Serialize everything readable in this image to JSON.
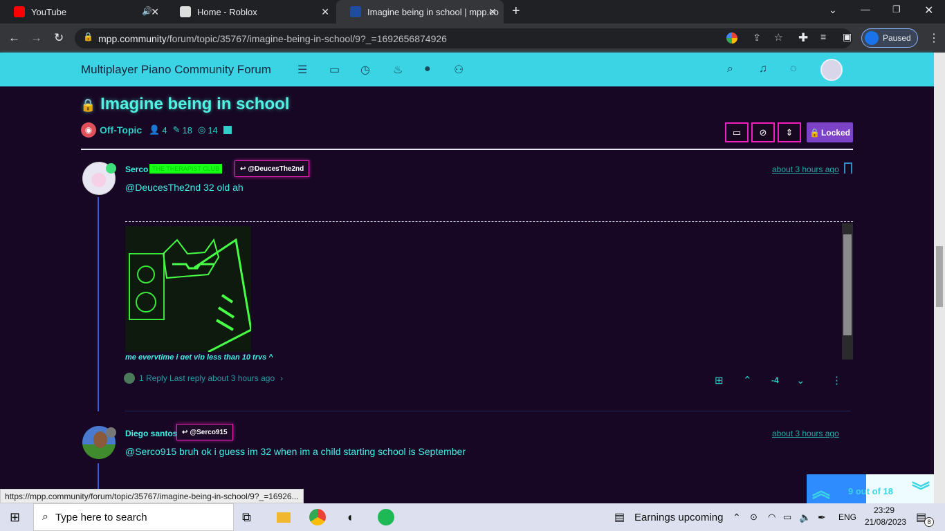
{
  "browser": {
    "tabs": [
      {
        "title": "YouTube"
      },
      {
        "title": "Home - Roblox"
      },
      {
        "title": "Imagine being in school | mpp.co"
      }
    ],
    "new_tab": "+",
    "url_host": "mpp.community",
    "url_path": "/forum/topic/35767/imagine-being-in-school/9?_=1692656874926",
    "profile_label": "Paused"
  },
  "forum": {
    "brand": "Multiplayer Piano Community Forum"
  },
  "topic": {
    "title": "Imagine being in school",
    "category": "Off-Topic",
    "posters": "4",
    "posts": "18",
    "views": "14",
    "locked_label": "Locked"
  },
  "posts": [
    {
      "username": "Serco",
      "badge": "THE THERAPIST CLUB",
      "reply_to": "@DeucesThe2nd",
      "time": "about 3 hours ago",
      "text": "@DeucesThe2nd 32 old ah",
      "signature": "me everytime i get vip less than 10 trys ^",
      "replies": "1 Reply Last reply about 3 hours ago",
      "votes": "-4"
    },
    {
      "username": "Diego santos",
      "reply_to": "@Serco915",
      "time": "about 3 hours ago",
      "text": "@Serco915 bruh ok i guess im 32 when im a child starting school is September"
    }
  ],
  "pager": {
    "text": "9 out of 18"
  },
  "status_url": "https://mpp.community/forum/topic/35767/imagine-being-in-school/9?_=16926...",
  "taskbar": {
    "search_placeholder": "Type here to search",
    "news": "Earnings upcoming",
    "lang": "ENG",
    "time": "23:29",
    "date": "21/08/2023",
    "notif_count": "8"
  },
  "colors": {
    "accent": "#3ad4e4",
    "text": "#43f0e6",
    "pink": "#f01fc0",
    "bg": "#170724"
  }
}
